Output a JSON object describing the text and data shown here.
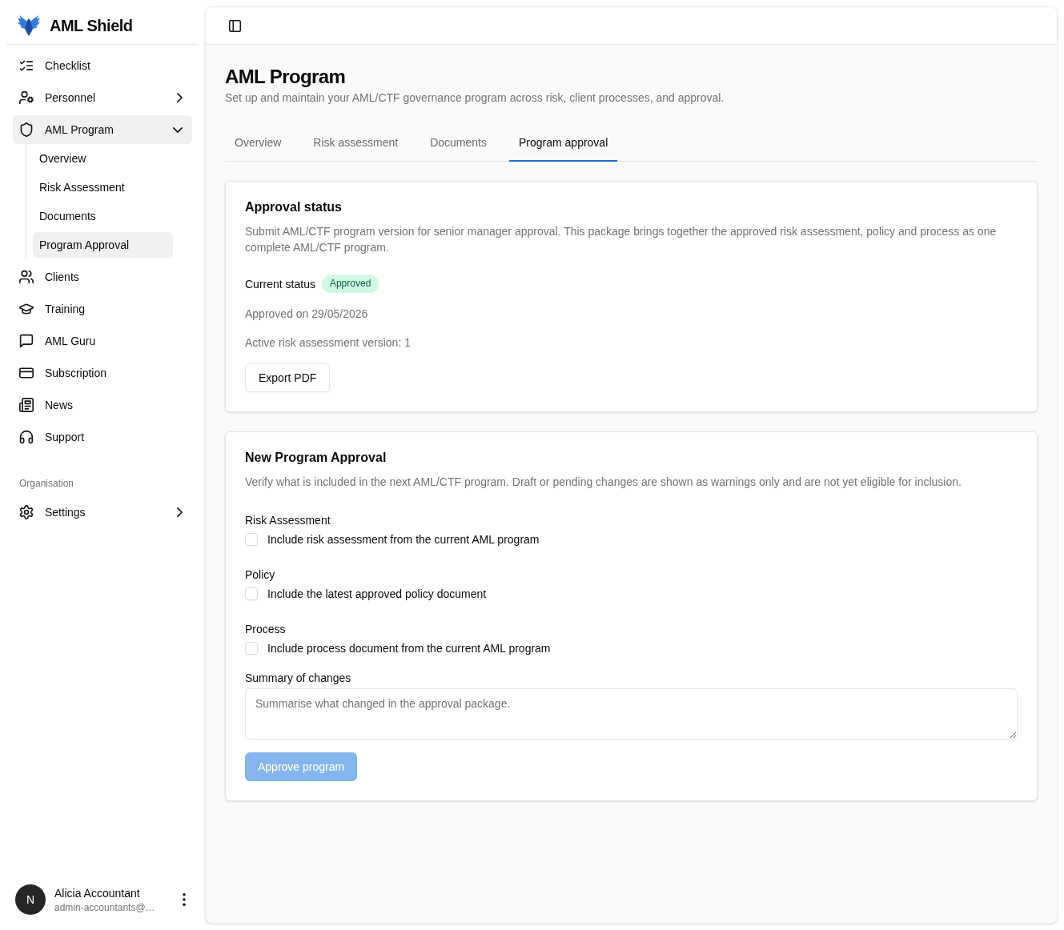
{
  "sidebar": {
    "brand": "AML Shield",
    "groups": [
      {
        "items": [
          {
            "label": "Checklist",
            "selected": false
          },
          {
            "label": "Personnel",
            "selected": false,
            "expanded": false
          },
          {
            "label": "AML Program",
            "selected": true,
            "expanded": true,
            "children": [
              {
                "label": "Overview",
                "selected": false
              },
              {
                "label": "Risk Assessment",
                "selected": false
              },
              {
                "label": "Documents",
                "selected": false
              },
              {
                "label": "Program Approval",
                "selected": true
              }
            ]
          },
          {
            "label": "Clients",
            "selected": false
          },
          {
            "label": "Training",
            "selected": false
          },
          {
            "label": "AML Guru",
            "selected": false
          },
          {
            "label": "Subscription",
            "selected": false
          },
          {
            "label": "News",
            "selected": false
          },
          {
            "label": "Support",
            "selected": false
          }
        ]
      },
      {
        "label": "Organisation",
        "items": [
          {
            "label": "Settings",
            "selected": false,
            "expanded": false
          }
        ]
      }
    ],
    "user": {
      "initial": "N",
      "name": "Alicia Accountant",
      "email": "admin-accountants@…"
    }
  },
  "main": {
    "title": "AML Program",
    "subtitle": "Set up and maintain your AML/CTF governance program across risk, client processes, and approval.",
    "tabs": [
      {
        "label": "Overview",
        "selected": false
      },
      {
        "label": "Risk assessment",
        "selected": false
      },
      {
        "label": "Documents",
        "selected": false
      },
      {
        "label": "Program approval",
        "selected": true
      }
    ],
    "approval_status": {
      "title": "Approval status",
      "description": "Submit AML/CTF program version for senior manager approval. This package brings together the approved risk assessment, policy and process as one complete AML/CTF program.",
      "status_label": "Current status",
      "status": "Approved",
      "approved_on": "Approved on 29/05/2026",
      "active_version": "Active risk assessment version: 1",
      "export_button": "Export PDF"
    },
    "new_approval": {
      "title": "New Program Approval",
      "description": "Verify what is included in the next AML/CTF program. Draft or pending changes are shown as warnings only and are not yet eligible for inclusion.",
      "sections": [
        {
          "heading": "Risk Assessment",
          "option": "Include risk assessment from the current AML program",
          "checked": false
        },
        {
          "heading": "Policy",
          "option": "Include the latest approved policy document",
          "checked": false
        },
        {
          "heading": "Process",
          "option": "Include process document from the current AML program",
          "checked": false
        }
      ],
      "summary": {
        "label": "Summary of changes",
        "placeholder": "Summarise what changed in the approval package."
      },
      "approve_button": {
        "label": "Approve program",
        "disabled": true
      }
    }
  }
}
